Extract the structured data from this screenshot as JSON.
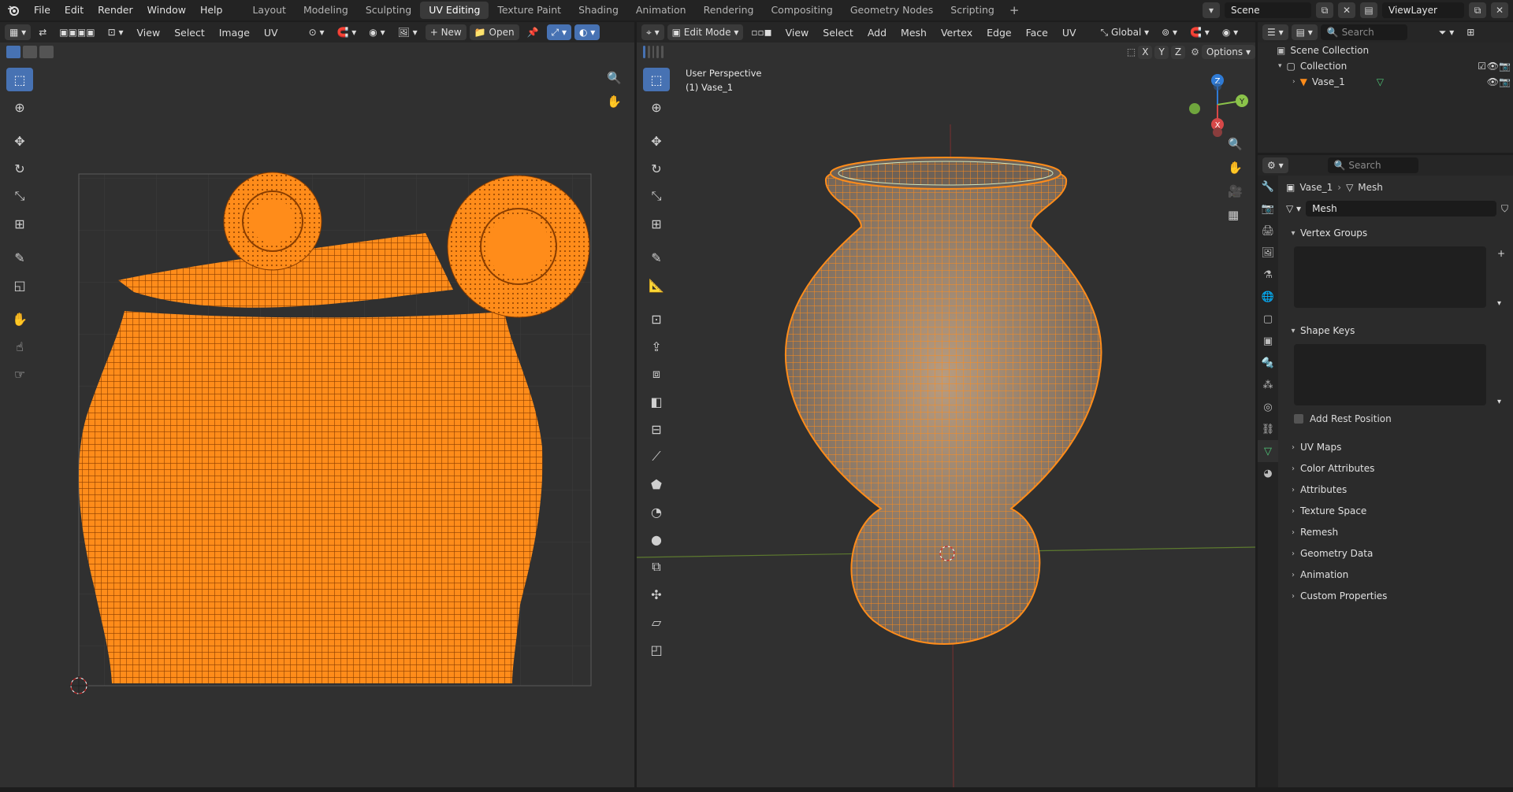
{
  "topbar": {
    "menus": [
      "File",
      "Edit",
      "Render",
      "Window",
      "Help"
    ],
    "workspaces": [
      "Layout",
      "Modeling",
      "Sculpting",
      "UV Editing",
      "Texture Paint",
      "Shading",
      "Animation",
      "Rendering",
      "Compositing",
      "Geometry Nodes",
      "Scripting"
    ],
    "active_workspace": "UV Editing",
    "scene_name": "Scene",
    "view_layer_name": "ViewLayer"
  },
  "uv_editor": {
    "menus": [
      "View",
      "Select",
      "Image",
      "UV"
    ],
    "new_label": "New",
    "open_label": "Open"
  },
  "viewport": {
    "mode": "Edit Mode",
    "menus": [
      "View",
      "Select",
      "Add",
      "Mesh",
      "Vertex",
      "Edge",
      "Face",
      "UV"
    ],
    "orientation": "Global",
    "axis_x": "X",
    "axis_y": "Y",
    "axis_z": "Z",
    "options_label": "Options",
    "perspective_label": "User Perspective",
    "object_label": "(1) Vase_1",
    "accent_color": "#ff8c1a"
  },
  "outliner": {
    "search_placeholder": "Search",
    "scene_collection": "Scene Collection",
    "collection": "Collection",
    "object": "Vase_1"
  },
  "properties": {
    "search_placeholder": "Search",
    "breadcrumb_object": "Vase_1",
    "breadcrumb_data": "Mesh",
    "mesh_name": "Mesh",
    "vertex_groups": "Vertex Groups",
    "shape_keys": "Shape Keys",
    "add_rest_position": "Add Rest Position",
    "panels": [
      "UV Maps",
      "Color Attributes",
      "Attributes",
      "Texture Space",
      "Remesh",
      "Geometry Data",
      "Animation",
      "Custom Properties"
    ]
  }
}
